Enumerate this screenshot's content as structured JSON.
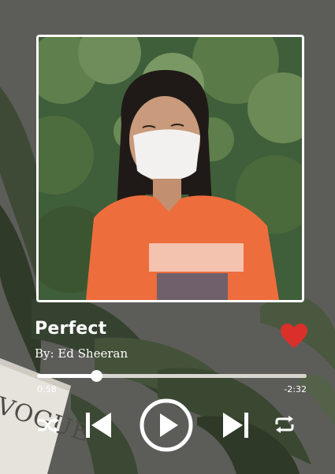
{
  "track": {
    "title": "Perfect",
    "artist_line": "By: Ed Sheeran",
    "liked": true
  },
  "playback": {
    "elapsed": "0:58",
    "remaining": "-2:32",
    "progress": 0.22,
    "state": "paused"
  },
  "background": {
    "magazine_text": "VOGUE"
  },
  "colors": {
    "accent_heart": "#d9302a",
    "text": "#ffffff",
    "track_bg": "#d8d6d0"
  },
  "icons": {
    "shuffle": "shuffle-icon",
    "previous": "skip-previous-icon",
    "play": "play-icon",
    "next": "skip-next-icon",
    "repeat": "repeat-icon",
    "like": "heart-icon"
  }
}
